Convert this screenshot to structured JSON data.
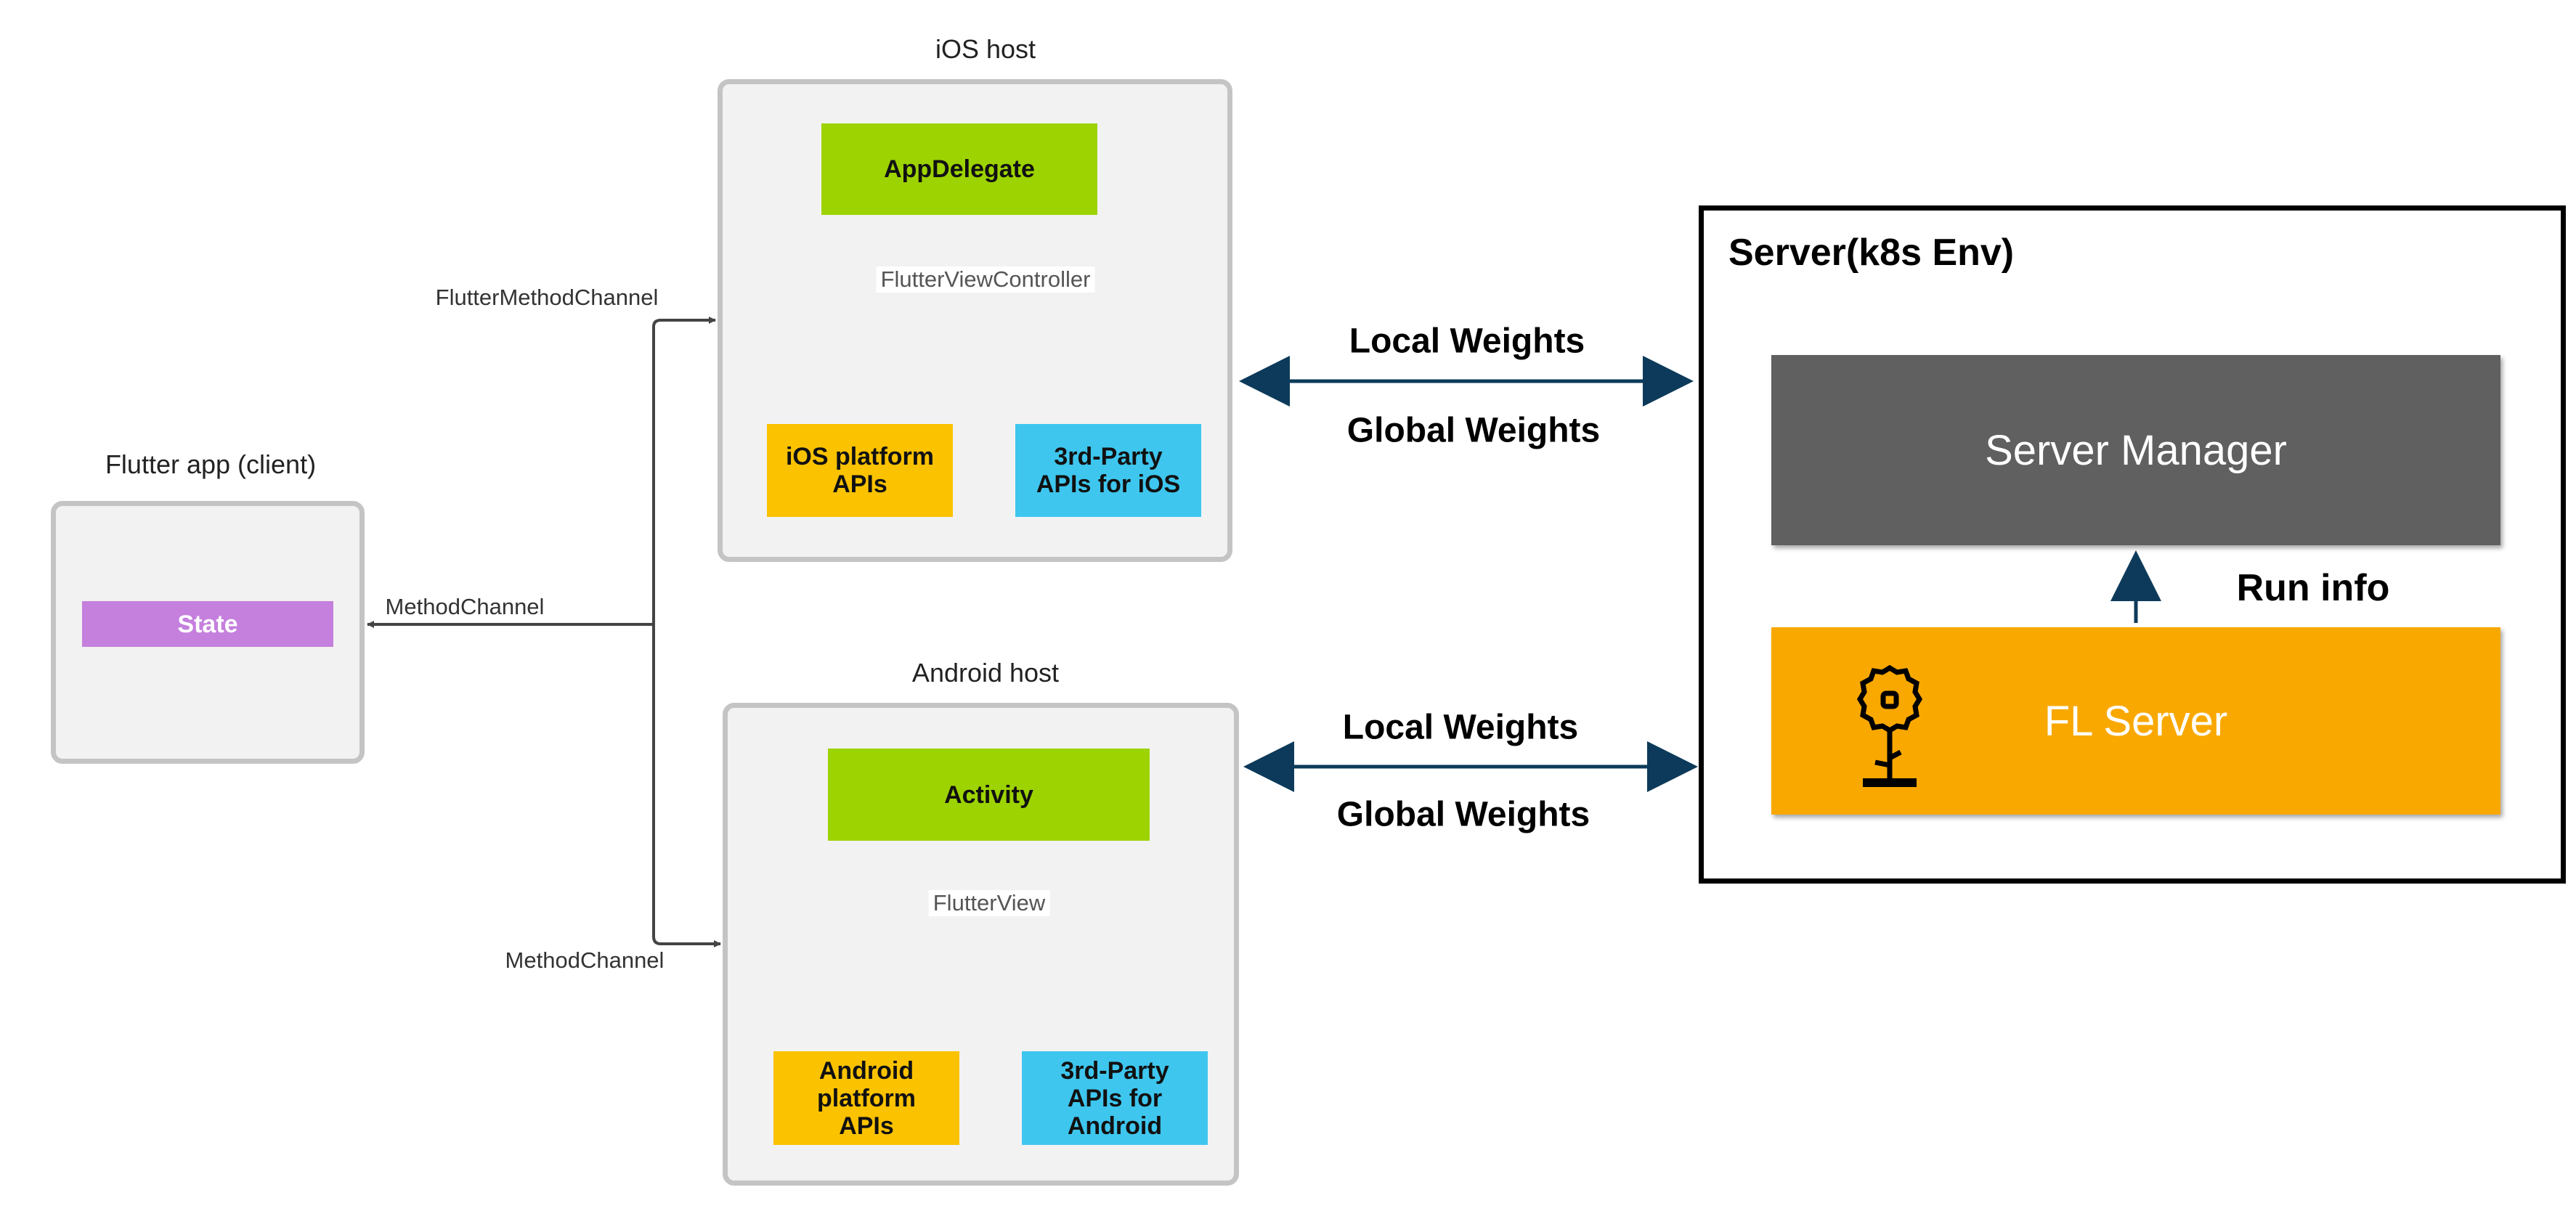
{
  "client": {
    "title": "Flutter app (client)",
    "state_label": "State"
  },
  "ios_host": {
    "title": "iOS host",
    "root": "AppDelegate",
    "connector": "FlutterViewController",
    "platform_apis": "iOS platform APIs",
    "third_party_apis": "3rd-Party APIs for iOS"
  },
  "android_host": {
    "title": "Android host",
    "root": "Activity",
    "connector": "FlutterView",
    "platform_apis": "Android platform APIs",
    "third_party_apis": "3rd-Party APIs for Android"
  },
  "channels": {
    "ios": "FlutterMethodChannel",
    "client": "MethodChannel",
    "android": "MethodChannel"
  },
  "links": {
    "ios_up": "Local Weights",
    "ios_down": "Global Weights",
    "android_up": "Local Weights",
    "android_down": "Global Weights"
  },
  "server": {
    "title": "Server(k8s Env)",
    "manager": "Server Manager",
    "run_info": "Run info",
    "fl_server": "FL Server",
    "fl_server_icon": "flower-icon"
  },
  "colors": {
    "green": "#9dd300",
    "yellow": "#fbc200",
    "blue": "#3ec6ee",
    "purple": "#c57fdd",
    "manager": "#606060",
    "fl_server": "#f9a800",
    "arrow": "#0d3a5a"
  }
}
